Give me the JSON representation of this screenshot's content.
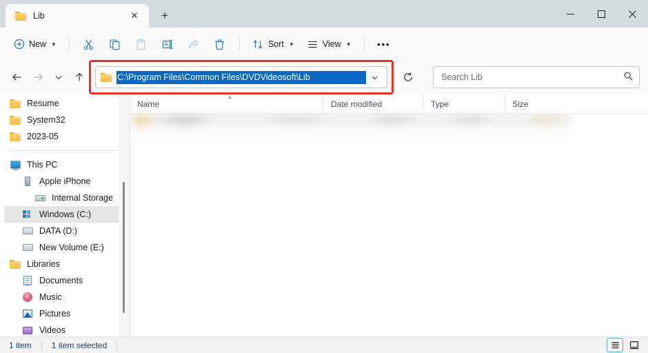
{
  "window": {
    "tab": {
      "title": "Lib",
      "icon": "folder-icon",
      "close_label": "✕"
    },
    "new_tab_label": "+",
    "controls": {
      "minimize": "minimize-icon",
      "maximize": "maximize-icon",
      "close": "close-icon"
    }
  },
  "toolbar": {
    "new_label": "New",
    "sort_label": "Sort",
    "view_label": "View",
    "more_label": "•••",
    "items": [
      {
        "name": "cut-button",
        "icon": "scissors-icon",
        "enabled": true
      },
      {
        "name": "copy-button",
        "icon": "copy-icon",
        "enabled": true
      },
      {
        "name": "paste-button",
        "icon": "clipboard-icon",
        "enabled": false
      },
      {
        "name": "rename-button",
        "icon": "rename-icon",
        "enabled": true
      },
      {
        "name": "share-button",
        "icon": "share-icon",
        "enabled": false
      },
      {
        "name": "delete-button",
        "icon": "trash-icon",
        "enabled": true
      }
    ]
  },
  "addressbar": {
    "path": "C:\\Program Files\\Common Files\\DVDVideosoft\\Lib",
    "selected": true,
    "highlight_color": "#0a67c2",
    "annotation_color": "#ef3124",
    "back_label": "←",
    "forward_label": "→",
    "recent_label": "⌄",
    "up_label": "↑",
    "refresh_label": "refresh-icon"
  },
  "search": {
    "placeholder": "Search Lib",
    "icon": "search-icon"
  },
  "sidebar": {
    "items": [
      {
        "label": "Resume",
        "icon": "folder-icon",
        "indent": 1,
        "selected": false
      },
      {
        "label": "System32",
        "icon": "folder-icon",
        "indent": 1,
        "selected": false
      },
      {
        "label": "2023-05",
        "icon": "folder-icon",
        "indent": 1,
        "selected": false
      },
      {
        "label": "This PC",
        "icon": "this-pc-icon",
        "indent": 1,
        "selected": false
      },
      {
        "label": "Apple iPhone",
        "icon": "phone-icon",
        "indent": 2,
        "selected": false
      },
      {
        "label": "Internal Storage",
        "icon": "internal-storage-icon",
        "indent": 3,
        "selected": false
      },
      {
        "label": "Windows (C:)",
        "icon": "windows-drive-icon",
        "indent": 2,
        "selected": true
      },
      {
        "label": "DATA (D:)",
        "icon": "drive-icon",
        "indent": 2,
        "selected": false
      },
      {
        "label": "New Volume (E:)",
        "icon": "drive-icon",
        "indent": 2,
        "selected": false
      },
      {
        "label": "Libraries",
        "icon": "folder-icon",
        "indent": 1,
        "selected": false
      },
      {
        "label": "Documents",
        "icon": "documents-icon",
        "indent": 2,
        "selected": false
      },
      {
        "label": "Music",
        "icon": "music-icon",
        "indent": 2,
        "selected": false
      },
      {
        "label": "Pictures",
        "icon": "pictures-icon",
        "indent": 2,
        "selected": false
      },
      {
        "label": "Videos",
        "icon": "videos-icon",
        "indent": 2,
        "selected": false
      }
    ]
  },
  "filelist": {
    "columns": [
      {
        "label": "Name",
        "sorted": true,
        "sort_direction": "ascending"
      },
      {
        "label": "Date modified",
        "sorted": false
      },
      {
        "label": "Type",
        "sorted": false
      },
      {
        "label": "Size",
        "sorted": false
      }
    ],
    "sort_indicator": "˄",
    "rows_redacted": true
  },
  "statusbar": {
    "item_count": "1 item",
    "selection": "1 item selected",
    "view_details": "details-view-icon",
    "view_large_icons": "large-icons-view-icon"
  }
}
